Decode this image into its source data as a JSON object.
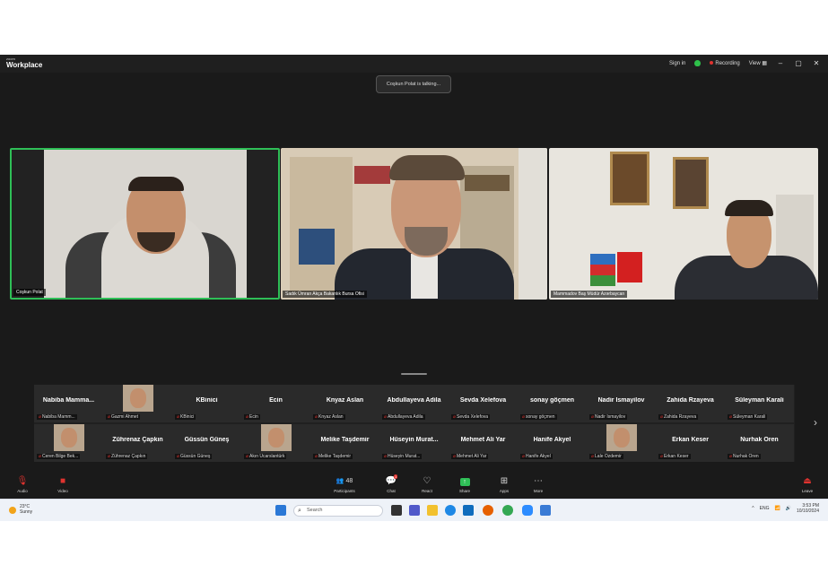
{
  "app": {
    "brand_small": "zoom",
    "brand_big": "Workplace"
  },
  "titlebar": {
    "sign_in": "Sign in",
    "recording": "Recording",
    "view": "View"
  },
  "talking_banner": "Coşkun Polat is talking...",
  "main_videos": [
    {
      "name": "Coşkun Polat"
    },
    {
      "name": "Sadık Ümran Akça Bakanlık Bursa Ofisi"
    },
    {
      "name": "Mammadov Baş Müdür Azərbaycan"
    }
  ],
  "gallery": {
    "row1": [
      {
        "display": "Nabiba Mamma...",
        "label": "Nabiba Mamm..."
      },
      {
        "display": "",
        "label": "Gazmi Ahmet",
        "photo": true
      },
      {
        "display": "KBinici",
        "label": "KBinici"
      },
      {
        "display": "Ecin",
        "label": "Ecin"
      },
      {
        "display": "Knyaz Aslan",
        "label": "Knyaz Aslan"
      },
      {
        "display": "Abdullayeva Adila",
        "label": "Abdullayeva Adila"
      },
      {
        "display": "Sevda Xelefova",
        "label": "Sevda Xelefova"
      },
      {
        "display": "sonay göçmen",
        "label": "sonay göçmen"
      },
      {
        "display": "Nadir İsmayilov",
        "label": "Nadir İsmayilov"
      },
      {
        "display": "Zahida Rzayeva",
        "label": "Zahida Rzayeva"
      },
      {
        "display": "Süleyman Karali",
        "label": "Süleyman Karali"
      }
    ],
    "row2": [
      {
        "display": "",
        "label": "Ceren Bilge Bek...",
        "photo": true
      },
      {
        "display": "Zührenaz Çapkın",
        "label": "Zührenaz Çapkın"
      },
      {
        "display": "Güssün Güneş",
        "label": "Güssün Güneş"
      },
      {
        "display": "",
        "label": "Akın Ucarslantürk",
        "photo": true
      },
      {
        "display": "Melike Taşdemir",
        "label": "Melike Taşdemir"
      },
      {
        "display": "Hüseyin Murat...",
        "label": "Hüseyin Murat..."
      },
      {
        "display": "Mehmet Ali Yar",
        "label": "Mehmet Ali Yar"
      },
      {
        "display": "Hanife Akyel",
        "label": "Hanife Akyel"
      },
      {
        "display": "",
        "label": "Lale Özdemir",
        "photo": true
      },
      {
        "display": "Erkan Keser",
        "label": "Erkan Keser"
      },
      {
        "display": "Nurhak Ören",
        "label": "Nurhak Ören"
      }
    ]
  },
  "toolbar": {
    "audio": "Audio",
    "video": "Video",
    "participants": "Participants",
    "participants_count": "48",
    "chat": "Chat",
    "chat_badge": "1",
    "react": "React",
    "share": "Share",
    "apps": "Apps",
    "more": "More",
    "leave": "Leave"
  },
  "taskbar": {
    "temp": "23°C",
    "weather": "Sunny",
    "search_placeholder": "Search",
    "lang": "ENG",
    "time": "3:53 PM",
    "date": "10/10/2024"
  },
  "colors": {
    "active_speaker": "#2fbf57",
    "recording": "#e0332f",
    "share": "#2fbf57"
  }
}
